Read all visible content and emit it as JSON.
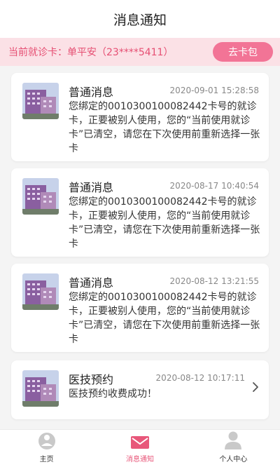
{
  "header": {
    "title": "消息通知"
  },
  "card_bar": {
    "current_card": "当前就诊卡：单平安（23****5411）",
    "wallet_button": "去卡包"
  },
  "messages": [
    {
      "title": "普通消息",
      "time": "2020-09-01 15:28:58",
      "body": "您绑定的0010300100082442卡号的就诊卡，正要被别人使用，您的“当前使用就诊卡”已清空，请您在下次使用前重新选择一张卡"
    },
    {
      "title": "普通消息",
      "time": "2020-08-17 10:40:54",
      "body": "您绑定的0010300100082442卡号的就诊卡，正要被别人使用，您的“当前使用就诊卡”已清空，请您在下次使用前重新选择一张卡"
    },
    {
      "title": "普通消息",
      "time": "2020-08-12 13:21:55",
      "body": "您绑定的0010300100082442卡号的就诊卡，正要被别人使用，您的“当前使用就诊卡”已清空，请您在下次使用前重新选择一张卡"
    },
    {
      "title": "医技预约",
      "time": "2020-08-12 10:17:11",
      "body": "医技预约收费成功！"
    }
  ],
  "tabbar": {
    "items": [
      {
        "label": "主页",
        "icon": "home-icon"
      },
      {
        "label": "消息通知",
        "icon": "mail-icon"
      },
      {
        "label": "个人中心",
        "icon": "person-icon"
      }
    ]
  },
  "colors": {
    "accent": "#e8577a",
    "banner_bg": "#fbe1e6",
    "button_bg": "#f27496"
  }
}
